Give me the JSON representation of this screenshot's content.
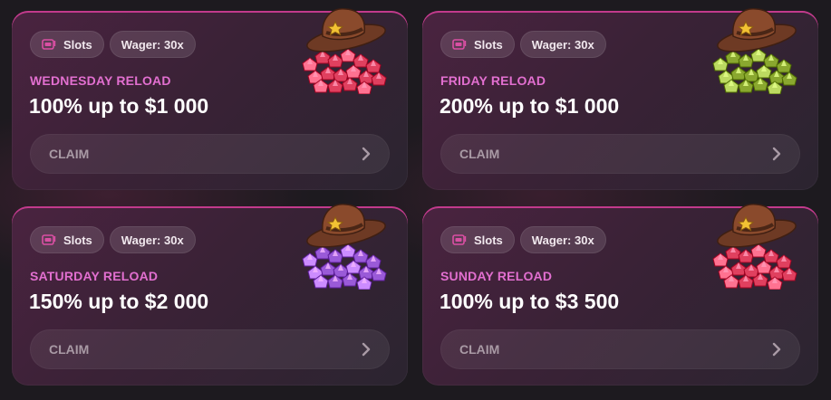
{
  "promos": [
    {
      "tag_category": "Slots",
      "tag_wager": "Wager: 30x",
      "title": "WEDNESDAY RELOAD",
      "offer": "100% up to $1 000",
      "cta": "CLAIM",
      "gem_color": "#e0405f",
      "art_icon": "cowboy-hat-red-gems"
    },
    {
      "tag_category": "Slots",
      "tag_wager": "Wager: 30x",
      "title": "FRIDAY RELOAD",
      "offer": "200% up to $1 000",
      "cta": "CLAIM",
      "gem_color": "#8aa82f",
      "art_icon": "cowboy-hat-green-gems"
    },
    {
      "tag_category": "Slots",
      "tag_wager": "Wager: 30x",
      "title": "SATURDAY RELOAD",
      "offer": "150% up to $2 000",
      "cta": "CLAIM",
      "gem_color": "#9a5ad8",
      "art_icon": "cowboy-hat-purple-gems"
    },
    {
      "tag_category": "Slots",
      "tag_wager": "Wager: 30x",
      "title": "SUNDAY RELOAD",
      "offer": "100% up to $3 500",
      "cta": "CLAIM",
      "gem_color": "#e0405f",
      "art_icon": "cowboy-hat-red-gems"
    }
  ],
  "colors": {
    "accent": "#e26fd0",
    "card_border": "#c23a8c",
    "background": "#1d1a1f"
  }
}
